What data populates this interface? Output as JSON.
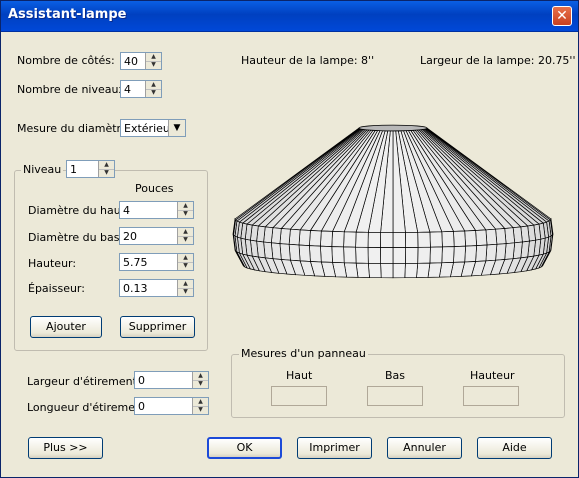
{
  "window": {
    "title": "Assistant-lampe",
    "close_icon": "close-icon"
  },
  "fields": {
    "sides": {
      "label": "Nombre de côtés:",
      "value": "40"
    },
    "levels": {
      "label": "Nombre de niveaux:",
      "value": "4"
    },
    "diameter_measure": {
      "label": "Mesure du diamètre:",
      "value": "Extérieur"
    }
  },
  "info": {
    "height": "Hauteur de la lampe: 8''",
    "width": "Largeur de la lampe: 20.75''"
  },
  "level_group": {
    "title": "Niveau",
    "level_value": "1",
    "units": "Pouces",
    "top_diameter": {
      "label": "Diamètre du haut:",
      "value": "4"
    },
    "bottom_diameter": {
      "label": "Diamètre du bas:",
      "value": "20"
    },
    "height": {
      "label": "Hauteur:",
      "value": "5.75"
    },
    "thickness": {
      "label": "Épaisseur:",
      "value": "0.13"
    },
    "add_label": "Ajouter",
    "delete_label": "Supprimer"
  },
  "stretch": {
    "width": {
      "label": "Largeur d'étirement:",
      "value": "0"
    },
    "length": {
      "label": "Longueur d'étirement:",
      "value": "0"
    }
  },
  "panel": {
    "title": "Mesures d'un panneau",
    "top": "Haut",
    "bottom": "Bas",
    "height": "Hauteur"
  },
  "buttons": {
    "more": "Plus >>",
    "ok": "OK",
    "print": "Imprimer",
    "cancel": "Annuler",
    "help": "Aide"
  }
}
